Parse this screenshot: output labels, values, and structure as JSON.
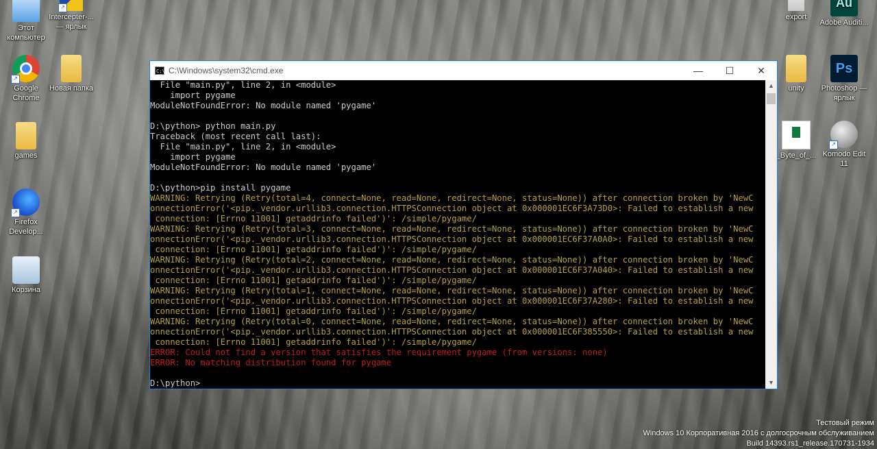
{
  "desktop": {
    "left_icons": [
      {
        "label": "Этот компьютер",
        "icon": "computer-icon"
      },
      {
        "label": "Google Chrome",
        "icon": "chrome-icon"
      },
      {
        "label": "games",
        "icon": "folder-icon"
      },
      {
        "label": "Firefox Develop...",
        "icon": "firefox-icon"
      },
      {
        "label": "Корзина",
        "icon": "recycle-bin-icon"
      }
    ],
    "second_column": [
      {
        "label": "Intercepter-... — ярлык",
        "icon": "intercepter-icon"
      },
      {
        "label": "Новая папка",
        "icon": "folder-icon"
      }
    ],
    "right_icons": [
      {
        "label": "export",
        "icon": "export-icon"
      },
      {
        "label": "Adobe Auditi...",
        "icon": "audition-icon",
        "glyph": "Au"
      },
      {
        "label": "unity",
        "icon": "folder-icon"
      },
      {
        "label": "Photoshop — ярлык",
        "icon": "photoshop-icon",
        "glyph": "Ps"
      },
      {
        "label": "_Byte_of_...",
        "icon": "document-icon"
      },
      {
        "label": "Komodo Edit 11",
        "icon": "komodo-icon"
      }
    ]
  },
  "cmd_window": {
    "title": "C:\\Windows\\system32\\cmd.exe",
    "icon_glyph": "C:\\",
    "minimize": "—",
    "maximize": "☐",
    "close": "✕",
    "scroll_up": "▲",
    "scroll_down": "▼",
    "lines": [
      {
        "text": "  File \"main.py\", line 2, in <module>",
        "type": "normal"
      },
      {
        "text": "    import pygame",
        "type": "normal"
      },
      {
        "text": "ModuleNotFoundError: No module named 'pygame'",
        "type": "normal"
      },
      {
        "text": "",
        "type": "normal"
      },
      {
        "text": "D:\\python> python main.py",
        "type": "normal"
      },
      {
        "text": "Traceback (most recent call last):",
        "type": "normal"
      },
      {
        "text": "  File \"main.py\", line 2, in <module>",
        "type": "normal"
      },
      {
        "text": "    import pygame",
        "type": "normal"
      },
      {
        "text": "ModuleNotFoundError: No module named 'pygame'",
        "type": "normal"
      },
      {
        "text": "",
        "type": "normal"
      },
      {
        "text": "D:\\python>pip install pygame",
        "type": "normal"
      },
      {
        "text": "WARNING: Retrying (Retry(total=4, connect=None, read=None, redirect=None, status=None)) after connection broken by 'NewC",
        "type": "warn"
      },
      {
        "text": "onnectionError('<pip._vendor.urllib3.connection.HTTPSConnection object at 0x000001EC6F3A73D0>: Failed to establish a new",
        "type": "warn"
      },
      {
        "text": " connection: [Errno 11001] getaddrinfo failed')': /simple/pygame/",
        "type": "warn"
      },
      {
        "text": "WARNING: Retrying (Retry(total=3, connect=None, read=None, redirect=None, status=None)) after connection broken by 'NewC",
        "type": "warn"
      },
      {
        "text": "onnectionError('<pip._vendor.urllib3.connection.HTTPSConnection object at 0x000001EC6F37A0A0>: Failed to establish a new",
        "type": "warn"
      },
      {
        "text": " connection: [Errno 11001] getaddrinfo failed')': /simple/pygame/",
        "type": "warn"
      },
      {
        "text": "WARNING: Retrying (Retry(total=2, connect=None, read=None, redirect=None, status=None)) after connection broken by 'NewC",
        "type": "warn"
      },
      {
        "text": "onnectionError('<pip._vendor.urllib3.connection.HTTPSConnection object at 0x000001EC6F37A040>: Failed to establish a new",
        "type": "warn"
      },
      {
        "text": " connection: [Errno 11001] getaddrinfo failed')': /simple/pygame/",
        "type": "warn"
      },
      {
        "text": "WARNING: Retrying (Retry(total=1, connect=None, read=None, redirect=None, status=None)) after connection broken by 'NewC",
        "type": "warn"
      },
      {
        "text": "onnectionError('<pip._vendor.urllib3.connection.HTTPSConnection object at 0x000001EC6F37A280>: Failed to establish a new",
        "type": "warn"
      },
      {
        "text": " connection: [Errno 11001] getaddrinfo failed')': /simple/pygame/",
        "type": "warn"
      },
      {
        "text": "WARNING: Retrying (Retry(total=0, connect=None, read=None, redirect=None, status=None)) after connection broken by 'NewC",
        "type": "warn"
      },
      {
        "text": "onnectionError('<pip._vendor.urllib3.connection.HTTPSConnection object at 0x000001EC6F385550>: Failed to establish a new",
        "type": "warn"
      },
      {
        "text": " connection: [Errno 11001] getaddrinfo failed')': /simple/pygame/",
        "type": "warn"
      },
      {
        "text": "ERROR: Could not find a version that satisfies the requirement pygame (from versions: none)",
        "type": "err"
      },
      {
        "text": "ERROR: No matching distribution found for pygame",
        "type": "err"
      },
      {
        "text": "",
        "type": "normal"
      },
      {
        "text": "D:\\python>",
        "type": "normal"
      }
    ]
  },
  "watermark": {
    "line1": "Тестовый режим",
    "line2": "Windows 10 Корпоративная 2016 с долгосрочным обслуживанием",
    "line3": "Build 14393.rs1_release.170731-1934"
  },
  "colors": {
    "console_text": "#cccccc",
    "warning": "#b8a13c",
    "error": "#c01c1c",
    "window_border": "#1883d7"
  }
}
